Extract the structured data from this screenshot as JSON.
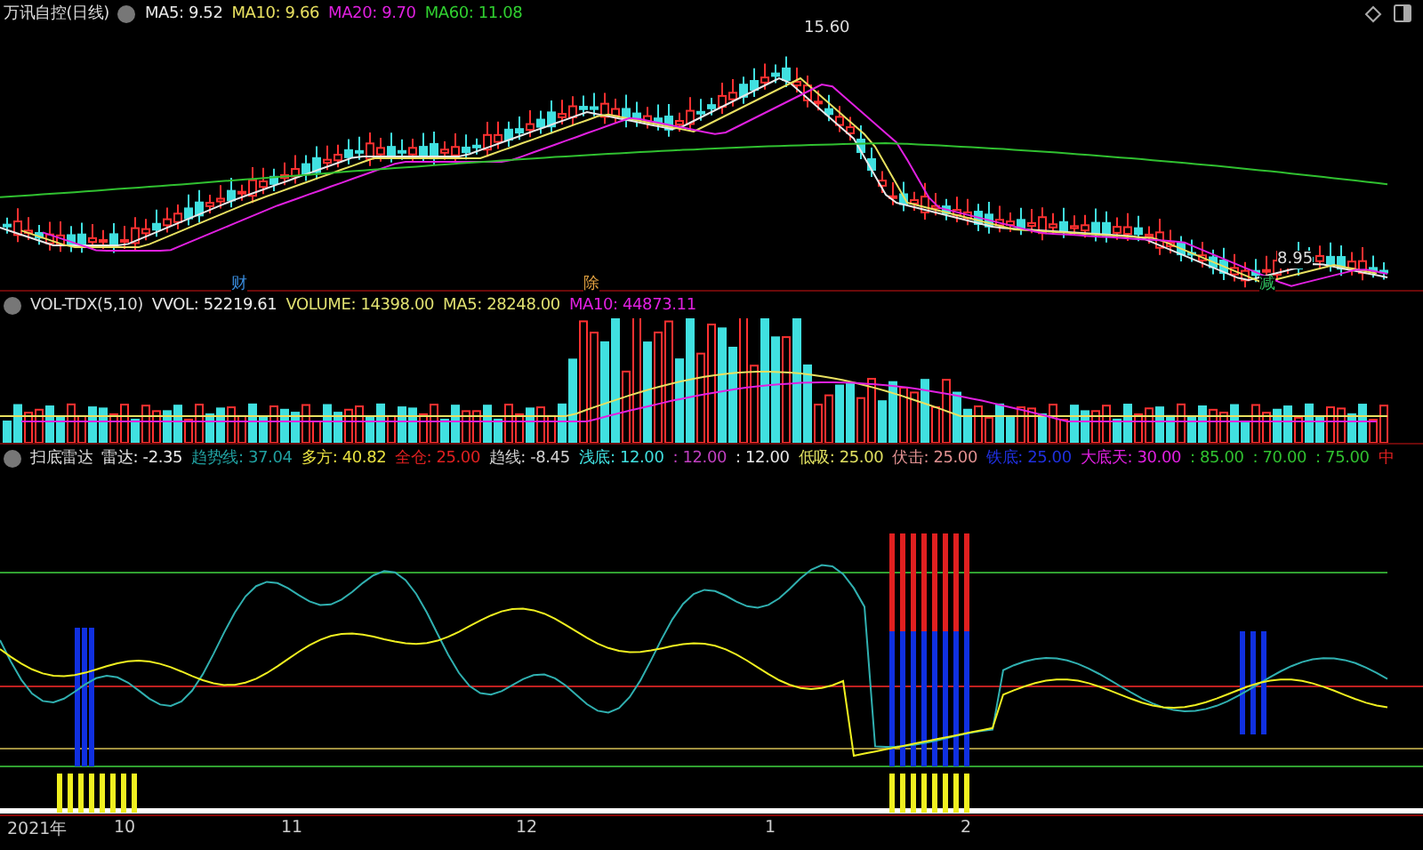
{
  "price_panel": {
    "title": "万讯自控(日线)",
    "legend": [
      {
        "text": "MA5: 9.52",
        "color": "#e8e8e8"
      },
      {
        "text": "MA10: 9.66",
        "color": "#e8e060"
      },
      {
        "text": "MA20: 9.70",
        "color": "#e020e0"
      },
      {
        "text": "MA60: 11.08",
        "color": "#30d030"
      }
    ],
    "high_label": "15.60",
    "low_label": "8.95",
    "markers": [
      {
        "text": "财",
        "color": "#3a8ee0"
      },
      {
        "text": "除",
        "color": "#e0a040"
      },
      {
        "text": "减",
        "color": "#30c060"
      }
    ]
  },
  "volume_panel": {
    "title": "VOL-TDX(5,10)",
    "legend": [
      {
        "text": "VVOL: 52219.61",
        "color": "#e8e8e8"
      },
      {
        "text": "VOLUME: 14398.00",
        "color": "#e0e070"
      },
      {
        "text": "MA5: 28248.00",
        "color": "#e0e070"
      },
      {
        "text": "MA10: 44873.11",
        "color": "#e020e0"
      }
    ]
  },
  "indicator_panel": {
    "title": "扫底雷达",
    "legend": [
      {
        "text": "雷达: -2.35",
        "color": "#e8e8e8"
      },
      {
        "text": "趋势线: 37.04",
        "color": "#20a0a0"
      },
      {
        "text": "多方: 40.82",
        "color": "#e8e040"
      },
      {
        "text": "全仓: 25.00",
        "color": "#e02020"
      },
      {
        "text": "趋线: -8.45",
        "color": "#d0d0d0"
      },
      {
        "text": "浅底: 12.00",
        "color": "#40e0e0"
      },
      {
        "text": ": 12.00",
        "color": "#c040c0"
      },
      {
        "text": ": 12.00",
        "color": "#e8e8e8"
      },
      {
        "text": "低吸: 25.00",
        "color": "#e0e060"
      },
      {
        "text": "伏击: 25.00",
        "color": "#e09090"
      },
      {
        "text": "铁底: 25.00",
        "color": "#2030e0"
      },
      {
        "text": "大底天: 30.00",
        "color": "#e020e0"
      },
      {
        "text": ": 85.00",
        "color": "#30c030"
      },
      {
        "text": ": 70.00",
        "color": "#30c030"
      },
      {
        "text": ": 75.00",
        "color": "#30c030"
      },
      {
        "text": "中",
        "color": "#e02020"
      }
    ]
  },
  "time_axis": [
    "2021年",
    "10",
    "11",
    "12",
    "1",
    "2"
  ]
}
